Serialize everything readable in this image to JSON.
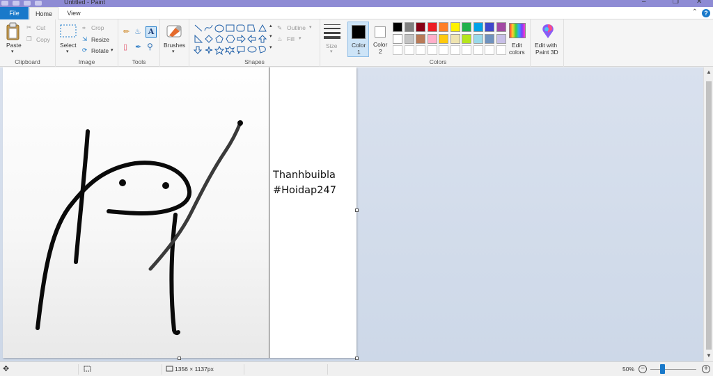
{
  "window": {
    "title": "Untitled - Paint",
    "controls": {
      "minimize": "–",
      "maximize": "❐",
      "close": "✕"
    }
  },
  "tabs": {
    "file": "File",
    "home": "Home",
    "view": "View"
  },
  "ribbon": {
    "clipboard": {
      "label": "Clipboard",
      "paste": "Paste",
      "cut": "Cut",
      "copy": "Copy"
    },
    "image": {
      "label": "Image",
      "select": "Select",
      "crop": "Crop",
      "resize": "Resize",
      "rotate": "Rotate"
    },
    "tools": {
      "label": "Tools"
    },
    "brushes": {
      "label": "Brushes"
    },
    "shapes": {
      "label": "Shapes",
      "outline": "Outline",
      "fill": "Fill"
    },
    "size": {
      "label": "Size"
    },
    "color1": {
      "label": "Color",
      "index": "1",
      "value": "#000000"
    },
    "color2": {
      "label": "Color",
      "index": "2",
      "value": "#ffffff"
    },
    "colors": {
      "label": "Colors",
      "edit_colors_line1": "Edit",
      "edit_colors_line2": "colors",
      "paint3d_line1": "Edit with",
      "paint3d_line2": "Paint 3D",
      "palette_row1": [
        "#000000",
        "#7f7f7f",
        "#880015",
        "#ed1c24",
        "#ff7f27",
        "#fff200",
        "#22b14c",
        "#00a2e8",
        "#3f48cc",
        "#a349a4"
      ],
      "palette_row2": [
        "#ffffff",
        "#c3c3c3",
        "#b97a57",
        "#ffaec9",
        "#ffc90e",
        "#efe4b0",
        "#b5e61d",
        "#99d9ea",
        "#7092be",
        "#c8bfe7"
      ],
      "palette_row3": [
        "#ffffff",
        "#ffffff",
        "#ffffff",
        "#ffffff",
        "#ffffff",
        "#ffffff",
        "#ffffff",
        "#ffffff",
        "#ffffff",
        "#ffffff"
      ]
    }
  },
  "canvas": {
    "text_line1": "Thanhbuibla",
    "text_line2": "#Hoidap247"
  },
  "status": {
    "image_size": "1356 × 1137px",
    "zoom": "50%",
    "zoom_fraction": 0.5,
    "zoom_out": "−",
    "zoom_in": "+"
  }
}
